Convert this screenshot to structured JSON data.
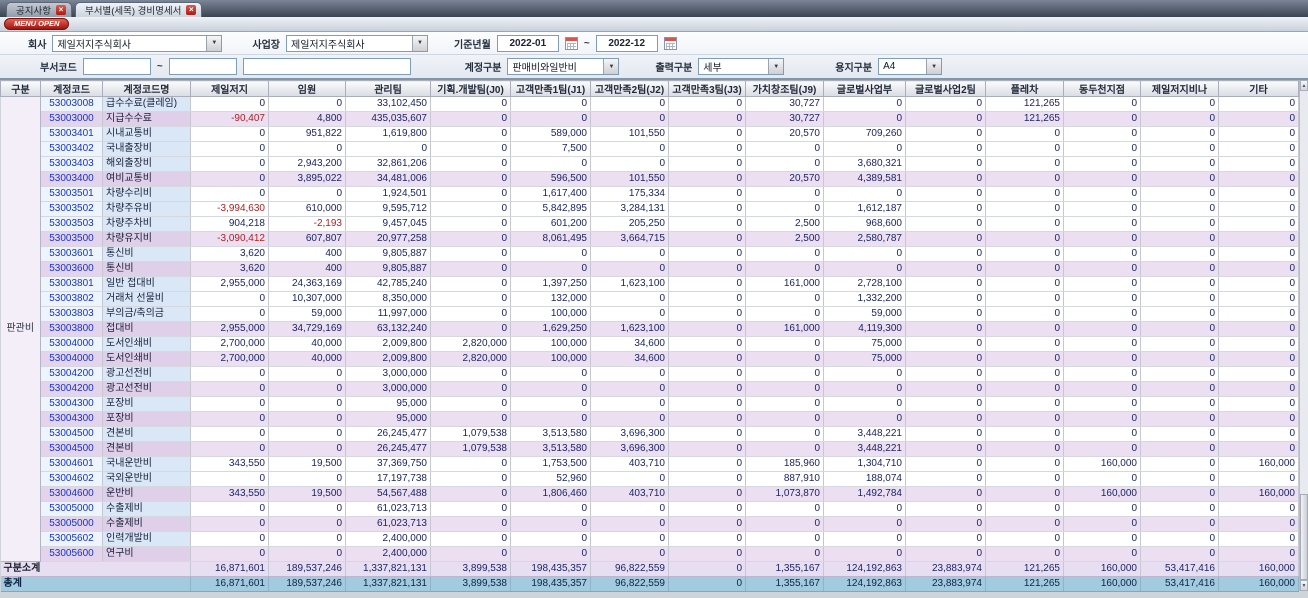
{
  "colors": {
    "menu_open_red": "#b8241a",
    "subtotal_row_lavender": "#ecdff2",
    "total_row_blue": "#a2cbdf",
    "detail_name_blue": "#d9e7f7",
    "code_text_blue": "#1535c8",
    "negative_red": "#b02020"
  },
  "tabs": [
    {
      "label": "공지사항"
    },
    {
      "label": "부서별(세목) 경비명세서"
    }
  ],
  "menu_open_label": "MENU OPEN",
  "filters": {
    "company_label": "회사",
    "company_value": "제일저지주식회사",
    "site_label": "사업장",
    "site_value": "제일저지주식회사",
    "period_label": "기준년월",
    "period_from": "2022-01",
    "period_tilde": "~",
    "period_to": "2022-12",
    "dept_label": "부서코드",
    "dept_from": "",
    "dept_tilde": "~",
    "dept_to": "",
    "dept_name": "",
    "account_label": "계정구분",
    "account_value": "판매비와일반비",
    "output_label": "출력구분",
    "output_value": "세부",
    "paper_label": "용지구분",
    "paper_value": "A4"
  },
  "table": {
    "columns": [
      "구분",
      "계정코드",
      "계정코드명",
      "제일저지",
      "임원",
      "관리팀",
      "기획.개발팀(J0)",
      "고객만족1팀(J1)",
      "고객만족2팀(J2)",
      "고객만족3팀(J3)",
      "가치창조팀(J9)",
      "글로벌사업부",
      "글로벌사업2팀",
      "플레차",
      "동두천지점",
      "제일저지비나",
      "기타"
    ],
    "group_label": "판관비",
    "rows": [
      {
        "t": "d",
        "code": "53003008",
        "name": "급수수료(클레임)",
        "v": [
          "0",
          "0",
          "33,102,450",
          "0",
          "0",
          "0",
          "0",
          "30,727",
          "0",
          "0",
          "121,265",
          "0",
          "0",
          "0"
        ]
      },
      {
        "t": "s",
        "code": "53003000",
        "name": "지급수수료",
        "v": [
          "-90,407",
          "4,800",
          "435,035,607",
          "0",
          "0",
          "0",
          "0",
          "30,727",
          "0",
          "0",
          "121,265",
          "0",
          "0",
          "0"
        ]
      },
      {
        "t": "d",
        "code": "53003401",
        "name": "시내교통비",
        "v": [
          "0",
          "951,822",
          "1,619,800",
          "0",
          "589,000",
          "101,550",
          "0",
          "20,570",
          "709,260",
          "0",
          "0",
          "0",
          "0",
          "0"
        ]
      },
      {
        "t": "d",
        "code": "53003402",
        "name": "국내출장비",
        "v": [
          "0",
          "0",
          "0",
          "0",
          "7,500",
          "0",
          "0",
          "0",
          "0",
          "0",
          "0",
          "0",
          "0",
          "0"
        ]
      },
      {
        "t": "d",
        "code": "53003403",
        "name": "해외출장비",
        "v": [
          "0",
          "2,943,200",
          "32,861,206",
          "0",
          "0",
          "0",
          "0",
          "0",
          "3,680,321",
          "0",
          "0",
          "0",
          "0",
          "0"
        ]
      },
      {
        "t": "s",
        "code": "53003400",
        "name": "여비교통비",
        "v": [
          "0",
          "3,895,022",
          "34,481,006",
          "0",
          "596,500",
          "101,550",
          "0",
          "20,570",
          "4,389,581",
          "0",
          "0",
          "0",
          "0",
          "0"
        ]
      },
      {
        "t": "d",
        "code": "53003501",
        "name": "차량수리비",
        "v": [
          "0",
          "0",
          "1,924,501",
          "0",
          "1,617,400",
          "175,334",
          "0",
          "0",
          "0",
          "0",
          "0",
          "0",
          "0",
          "0"
        ]
      },
      {
        "t": "d",
        "code": "53003502",
        "name": "차량주유비",
        "v": [
          "-3,994,630",
          "610,000",
          "9,595,712",
          "0",
          "5,842,895",
          "3,284,131",
          "0",
          "0",
          "1,612,187",
          "0",
          "0",
          "0",
          "0",
          "0"
        ]
      },
      {
        "t": "d",
        "code": "53003503",
        "name": "차량주차비",
        "v": [
          "904,218",
          "-2,193",
          "9,457,045",
          "0",
          "601,200",
          "205,250",
          "0",
          "2,500",
          "968,600",
          "0",
          "0",
          "0",
          "0",
          "0"
        ]
      },
      {
        "t": "s",
        "code": "53003500",
        "name": "차량유지비",
        "v": [
          "-3,090,412",
          "607,807",
          "20,977,258",
          "0",
          "8,061,495",
          "3,664,715",
          "0",
          "2,500",
          "2,580,787",
          "0",
          "0",
          "0",
          "0",
          "0"
        ]
      },
      {
        "t": "d",
        "code": "53003601",
        "name": "통신비",
        "v": [
          "3,620",
          "400",
          "9,805,887",
          "0",
          "0",
          "0",
          "0",
          "0",
          "0",
          "0",
          "0",
          "0",
          "0",
          "0"
        ]
      },
      {
        "t": "s",
        "code": "53003600",
        "name": "통신비",
        "v": [
          "3,620",
          "400",
          "9,805,887",
          "0",
          "0",
          "0",
          "0",
          "0",
          "0",
          "0",
          "0",
          "0",
          "0",
          "0"
        ]
      },
      {
        "t": "d",
        "code": "53003801",
        "name": "일반 접대비",
        "v": [
          "2,955,000",
          "24,363,169",
          "42,785,240",
          "0",
          "1,397,250",
          "1,623,100",
          "0",
          "161,000",
          "2,728,100",
          "0",
          "0",
          "0",
          "0",
          "0"
        ]
      },
      {
        "t": "d",
        "code": "53003802",
        "name": "거래처 선물비",
        "v": [
          "0",
          "10,307,000",
          "8,350,000",
          "0",
          "132,000",
          "0",
          "0",
          "0",
          "1,332,200",
          "0",
          "0",
          "0",
          "0",
          "0"
        ]
      },
      {
        "t": "d",
        "code": "53003803",
        "name": "부의금/축의금",
        "v": [
          "0",
          "59,000",
          "11,997,000",
          "0",
          "100,000",
          "0",
          "0",
          "0",
          "59,000",
          "0",
          "0",
          "0",
          "0",
          "0"
        ]
      },
      {
        "t": "s",
        "code": "53003800",
        "name": "접대비",
        "v": [
          "2,955,000",
          "34,729,169",
          "63,132,240",
          "0",
          "1,629,250",
          "1,623,100",
          "0",
          "161,000",
          "4,119,300",
          "0",
          "0",
          "0",
          "0",
          "0"
        ]
      },
      {
        "t": "d",
        "code": "53004000",
        "name": "도서인쇄비",
        "v": [
          "2,700,000",
          "40,000",
          "2,009,800",
          "2,820,000",
          "100,000",
          "34,600",
          "0",
          "0",
          "75,000",
          "0",
          "0",
          "0",
          "0",
          "0"
        ]
      },
      {
        "t": "s",
        "code": "53004000",
        "name": "도서인쇄비",
        "v": [
          "2,700,000",
          "40,000",
          "2,009,800",
          "2,820,000",
          "100,000",
          "34,600",
          "0",
          "0",
          "75,000",
          "0",
          "0",
          "0",
          "0",
          "0"
        ]
      },
      {
        "t": "d",
        "code": "53004200",
        "name": "광고선전비",
        "v": [
          "0",
          "0",
          "3,000,000",
          "0",
          "0",
          "0",
          "0",
          "0",
          "0",
          "0",
          "0",
          "0",
          "0",
          "0"
        ]
      },
      {
        "t": "s",
        "code": "53004200",
        "name": "광고선전비",
        "v": [
          "0",
          "0",
          "3,000,000",
          "0",
          "0",
          "0",
          "0",
          "0",
          "0",
          "0",
          "0",
          "0",
          "0",
          "0"
        ]
      },
      {
        "t": "d",
        "code": "53004300",
        "name": "포장비",
        "v": [
          "0",
          "0",
          "95,000",
          "0",
          "0",
          "0",
          "0",
          "0",
          "0",
          "0",
          "0",
          "0",
          "0",
          "0"
        ]
      },
      {
        "t": "s",
        "code": "53004300",
        "name": "포장비",
        "v": [
          "0",
          "0",
          "95,000",
          "0",
          "0",
          "0",
          "0",
          "0",
          "0",
          "0",
          "0",
          "0",
          "0",
          "0"
        ]
      },
      {
        "t": "d",
        "code": "53004500",
        "name": "견본비",
        "v": [
          "0",
          "0",
          "26,245,477",
          "1,079,538",
          "3,513,580",
          "3,696,300",
          "0",
          "0",
          "3,448,221",
          "0",
          "0",
          "0",
          "0",
          "0"
        ]
      },
      {
        "t": "s",
        "code": "53004500",
        "name": "견본비",
        "v": [
          "0",
          "0",
          "26,245,477",
          "1,079,538",
          "3,513,580",
          "3,696,300",
          "0",
          "0",
          "3,448,221",
          "0",
          "0",
          "0",
          "0",
          "0"
        ]
      },
      {
        "t": "d",
        "code": "53004601",
        "name": "국내운반비",
        "v": [
          "343,550",
          "19,500",
          "37,369,750",
          "0",
          "1,753,500",
          "403,710",
          "0",
          "185,960",
          "1,304,710",
          "0",
          "0",
          "160,000",
          "0",
          "160,000"
        ]
      },
      {
        "t": "d",
        "code": "53004602",
        "name": "국외운반비",
        "v": [
          "0",
          "0",
          "17,197,738",
          "0",
          "52,960",
          "0",
          "0",
          "887,910",
          "188,074",
          "0",
          "0",
          "0",
          "0",
          "0"
        ]
      },
      {
        "t": "s",
        "code": "53004600",
        "name": "운반비",
        "v": [
          "343,550",
          "19,500",
          "54,567,488",
          "0",
          "1,806,460",
          "403,710",
          "0",
          "1,073,870",
          "1,492,784",
          "0",
          "0",
          "160,000",
          "0",
          "160,000"
        ]
      },
      {
        "t": "d",
        "code": "53005000",
        "name": "수출제비",
        "v": [
          "0",
          "0",
          "61,023,713",
          "0",
          "0",
          "0",
          "0",
          "0",
          "0",
          "0",
          "0",
          "0",
          "0",
          "0"
        ]
      },
      {
        "t": "s",
        "code": "53005000",
        "name": "수출제비",
        "v": [
          "0",
          "0",
          "61,023,713",
          "0",
          "0",
          "0",
          "0",
          "0",
          "0",
          "0",
          "0",
          "0",
          "0",
          "0"
        ]
      },
      {
        "t": "d",
        "code": "53005602",
        "name": "인력개발비",
        "v": [
          "0",
          "0",
          "2,400,000",
          "0",
          "0",
          "0",
          "0",
          "0",
          "0",
          "0",
          "0",
          "0",
          "0",
          "0"
        ]
      },
      {
        "t": "s",
        "code": "53005600",
        "name": "연구비",
        "v": [
          "0",
          "0",
          "2,400,000",
          "0",
          "0",
          "0",
          "0",
          "0",
          "0",
          "0",
          "0",
          "0",
          "0",
          "0"
        ]
      },
      {
        "t": "g",
        "label": "구분소계",
        "v": [
          "16,871,601",
          "189,537,246",
          "1,337,821,131",
          "3,899,538",
          "198,435,357",
          "96,822,559",
          "0",
          "1,355,167",
          "124,192,863",
          "23,883,974",
          "121,265",
          "160,000",
          "53,417,416",
          "160,000"
        ]
      },
      {
        "t": "T",
        "label": "총계",
        "v": [
          "16,871,601",
          "189,537,246",
          "1,337,821,131",
          "3,899,538",
          "198,435,357",
          "96,822,559",
          "0",
          "1,355,167",
          "124,192,863",
          "23,883,974",
          "121,265",
          "160,000",
          "53,417,416",
          "160,000"
        ]
      }
    ]
  }
}
